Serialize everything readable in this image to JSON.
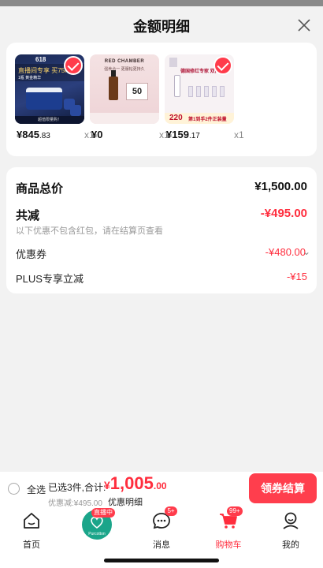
{
  "sheet": {
    "title": "金额明细",
    "close_icon": "close-icon"
  },
  "products": [
    {
      "thumb_text": "直播间专享 买75ml赠",
      "thumb_subtext": "1瓶 黄金精华",
      "thumb_badge": "618",
      "thumb_footer": "超值限量购！",
      "price_int": "845",
      "price_dec": ".83",
      "qty": "x1"
    },
    {
      "thumb_brand": "RED CHAMBER",
      "thumb_subtext": "强养合一 更服帖更持久",
      "thumb_tag": "50",
      "price_int": "0",
      "price_dec": "",
      "qty": "x1"
    },
    {
      "thumb_header": "德国修红专家 双向修护",
      "thumb_number": "220",
      "thumb_strip": "第1到手2件正装量",
      "price_int": "159",
      "price_dec": ".17",
      "qty": "x1"
    }
  ],
  "currency": "¥",
  "summary": {
    "total_label": "商品总价",
    "total_value": "¥1,500.00",
    "reduce_label": "共减",
    "reduce_value": "-¥495.00",
    "reduce_note": "以下优惠不包含红包，请在结算页查看",
    "coupon_label": "优惠券",
    "coupon_value": "-¥480.00",
    "plus_label": "PLUS专享立减",
    "plus_value": "-¥15"
  },
  "checkout": {
    "select_all": "全选",
    "picked": "已选3件,合计:",
    "total_cur": "¥",
    "total_int": "1,005",
    "total_dec": ".00",
    "discount": "优惠减:¥495.00",
    "detail_link": "优惠明细",
    "pay_button": "领券结算"
  },
  "tabbar": {
    "home": "首页",
    "live_tag": "直播中",
    "live_sub": "Purcotton",
    "messages": "消息",
    "messages_badge": "5+",
    "cart": "购物车",
    "cart_badge": "99+",
    "mine": "我的"
  },
  "colors": {
    "accent": "#ff2d3d",
    "button": "#ff3e4d",
    "live": "#1ba58a"
  }
}
